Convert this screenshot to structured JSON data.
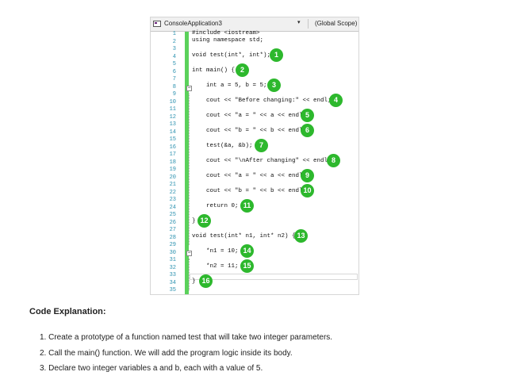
{
  "ide": {
    "project": "ConsoleApplication3",
    "scope": "(Global Scope)",
    "line_numbers": [
      "1",
      "2",
      "3",
      "4",
      "5",
      "6",
      "7",
      "8",
      "9",
      "10",
      "11",
      "12",
      "13",
      "14",
      "15",
      "16",
      "17",
      "18",
      "19",
      "20",
      "21",
      "22",
      "23",
      "24",
      "25",
      "26",
      "27",
      "28",
      "29",
      "30",
      "31",
      "32",
      "33",
      "34",
      "35"
    ],
    "code": {
      "l1": "#include <iostream>",
      "l2": "using namespace std;",
      "l4": "void test(int*, int*);",
      "l6": "int main() {",
      "l8": "int a = 5, b = 5;",
      "l10": "cout << \"Before changing:\" << endl;",
      "l12": "cout << \"a = \" << a << endl;",
      "l14": "cout << \"b = \" << b << endl;",
      "l16": "test(&a, &b);",
      "l18": "cout << \"\\nAfter changing\" << endl;",
      "l20": "cout << \"a = \" << a << endl;",
      "l22": "cout << \"b = \" << b << endl;",
      "l24": "return 0;",
      "l26": "}",
      "l28": "void test(int* n1, int* n2) {",
      "l30": "*n1 = 10;",
      "l32": "*n2 = 11;",
      "l34": "}"
    },
    "badges": [
      "1",
      "2",
      "3",
      "4",
      "5",
      "6",
      "7",
      "8",
      "9",
      "10",
      "11",
      "12",
      "13",
      "14",
      "15",
      "16"
    ],
    "fold_glyph": "−",
    "dropdown_glyph": "▾",
    "accent_green": "#2db82d"
  },
  "explanation": {
    "title": "Code Explanation:",
    "steps": [
      "1. Create a prototype of a function named  test that  will take two  integer parameters.",
      "2. Call the main() function. We will add the program  logic inside  its body.",
      "3. Declare  two integer variables  a and  b, each with  a value of 5."
    ]
  }
}
